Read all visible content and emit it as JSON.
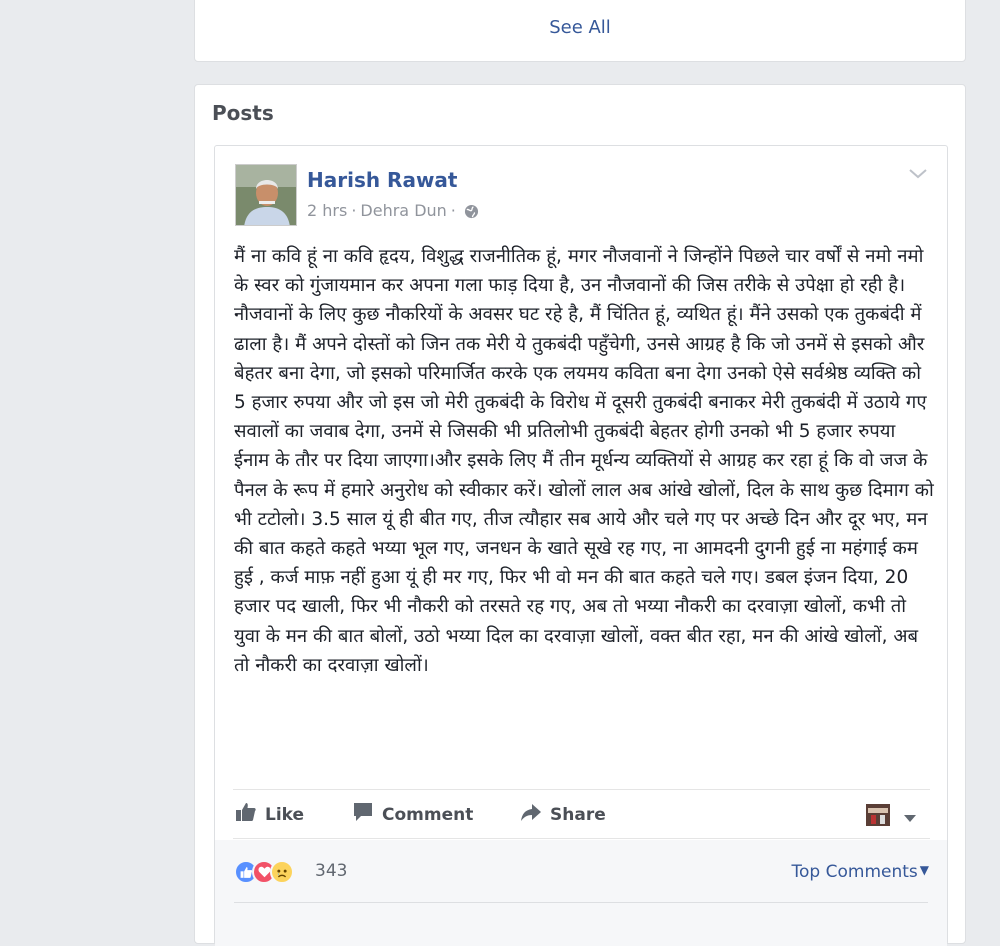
{
  "top_card": {
    "see_all": "See All"
  },
  "posts_section": {
    "title": "Posts"
  },
  "post": {
    "author": "Harish Rawat",
    "time": "2 hrs",
    "location": "Dehra Dun",
    "separator": "·",
    "body": "मैं ना कवि हूं ना कवि हृदय, विशुद्ध राजनीतिक हूं, मगर नौजवानों ने जिन्होंने पिछले चार वर्षों से नमो नमो के स्वर को गुंजायमान कर अपना गला फाड़ दिया है, उन नौजवानों की जिस तरीके से उपेक्षा हो रही है।नौजवानों के लिए कुछ नौकरियों के अवसर घट रहे है, मैं चिंतित हूं, व्यथित हूं। मैंने उसको एक तुकबंदी में ढाला है। मैं अपने दोस्तों को जिन तक मेरी ये तुकबंदी पहुँचेगी, उनसे आग्रह है कि जो उनमें से इसको और बेहतर बना देगा, जो इसको परिमार्जित करके एक लयमय कविता बना देगा उनको ऐसे सर्वश्रेष्ठ व्यक्ति को 5 हजार रुपया और जो इस जो मेरी तुकबंदी के विरोध में दूसरी तुकबंदी बनाकर मेरी तुकबंदी में उठाये गए सवालों का जवाब देगा, उनमें से जिसकी भी प्रतिलोभी तुकबंदी बेहतर होगी उनको भी 5 हजार रुपया ईनाम के तौर पर दिया जाएगा।और इसके लिए मैं तीन मूर्धन्य व्यक्तियों से आग्रह कर रहा हूं कि वो जज के पैनल के रूप में हमारे अनुरोध को स्वीकार करें। खोलों लाल अब आंखे खोलों, दिल के साथ कुछ दिमाग को भी टटोलो। 3.5 साल यूं ही बीत गए, तीज त्यौहार सब आये और चले गए पर अच्छे दिन और दूर भए, मन की बात कहते कहते भय्या भूल गए, जनधन के खाते सूखे रह गए, ना आमदनी दुगनी हुई ना महंगाई कम हुई , कर्ज माफ़ नहीं हुआ यूं ही मर गए, फिर भी वो मन की बात कहते चले गए। डबल इंजन दिया, 20 हजार पद खाली, फिर भी नौकरी को तरसते रह गए, अब तो भय्या नौकरी का दरवाज़ा खोलों, कभी तो युवा के मन की बात बोलों, उठो भय्या दिल का दरवाज़ा खोलों, वक्त बीत रहा, मन की आंखे खोलों, अब तो नौकरी का दरवाज़ा खोलों।",
    "actions": {
      "like": "Like",
      "comment": "Comment",
      "share": "Share"
    },
    "reactions": {
      "count": "343",
      "top_comments": "Top Comments"
    }
  },
  "colors": {
    "link": "#365899",
    "like_blue": "#5890ff",
    "love_red": "#f25268",
    "sad_yellow": "#fcd35c"
  },
  "icons": [
    "globe-icon",
    "chevron-down-icon",
    "like-icon",
    "comment-icon",
    "share-icon",
    "audience-avatar-icon",
    "caret-down-icon"
  ]
}
